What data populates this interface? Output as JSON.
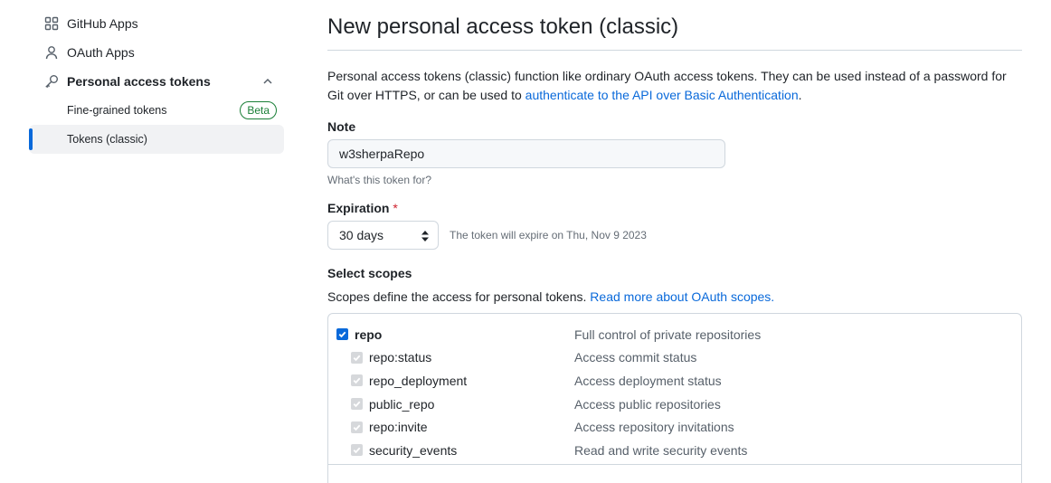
{
  "sidebar": {
    "items": [
      {
        "label": "GitHub Apps",
        "icon": "apps-grid-icon"
      },
      {
        "label": "OAuth Apps",
        "icon": "person-icon"
      },
      {
        "label": "Personal access tokens",
        "icon": "key-icon"
      }
    ],
    "subitems": [
      {
        "label": "Fine-grained tokens",
        "badge": "Beta"
      },
      {
        "label": "Tokens (classic)",
        "active": true
      }
    ]
  },
  "main": {
    "title": "New personal access token (classic)",
    "intro_text": "Personal access tokens (classic) function like ordinary OAuth access tokens. They can be used instead of a password for Git over HTTPS, or can be used to",
    "intro_link": "authenticate to the API over Basic Authentication",
    "intro_end": ".",
    "note": {
      "label": "Note",
      "value": "w3sherpaRepo",
      "hint": "What's this token for?"
    },
    "expiration": {
      "label": "Expiration",
      "required_mark": "*",
      "selected": "30 days",
      "note": "The token will expire on Thu, Nov 9 2023"
    },
    "scopes": {
      "label": "Select scopes",
      "desc": "Scopes define the access for personal tokens.",
      "link": "Read more about OAuth scopes.",
      "items": [
        {
          "name": "repo",
          "desc": "Full control of private repositories",
          "checked": true,
          "level": "parent"
        },
        {
          "name": "repo:status",
          "desc": "Access commit status",
          "checked": true,
          "level": "child"
        },
        {
          "name": "repo_deployment",
          "desc": "Access deployment status",
          "checked": true,
          "level": "child"
        },
        {
          "name": "public_repo",
          "desc": "Access public repositories",
          "checked": true,
          "level": "child"
        },
        {
          "name": "repo:invite",
          "desc": "Access repository invitations",
          "checked": true,
          "level": "child"
        },
        {
          "name": "security_events",
          "desc": "Read and write security events",
          "checked": true,
          "level": "child"
        }
      ]
    }
  },
  "colors": {
    "accent": "#0969da",
    "beta_green": "#1a7f37",
    "required_red": "#cf222e",
    "muted_text": "#656d76"
  }
}
